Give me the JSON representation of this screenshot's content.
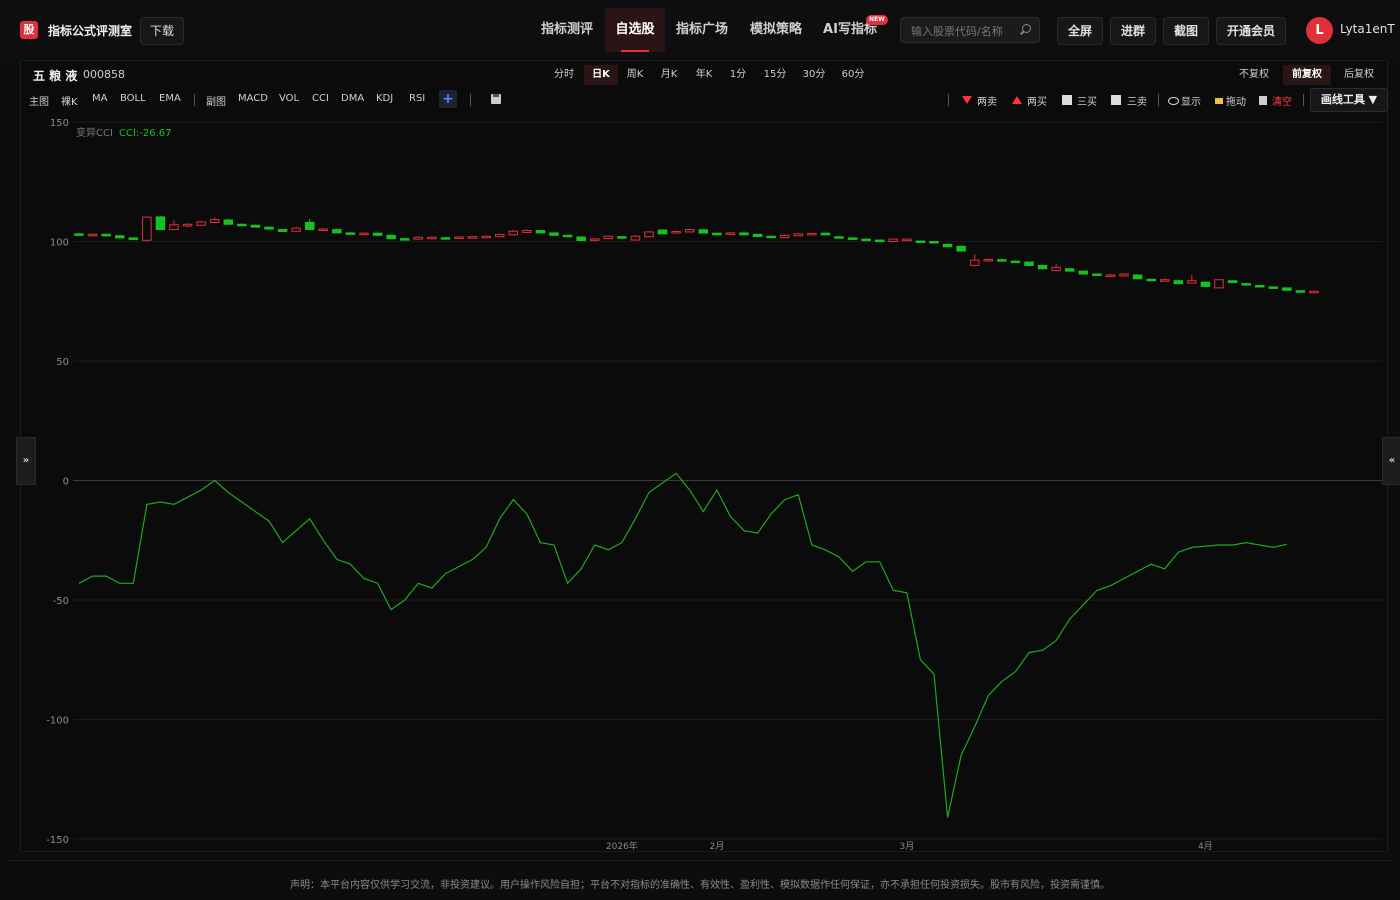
{
  "app": {
    "logo_char": "股",
    "title": "指标公式评测室",
    "download_label": "下载"
  },
  "nav": {
    "items": [
      {
        "label": "指标测评",
        "active": false
      },
      {
        "label": "自选股",
        "active": true
      },
      {
        "label": "指标广场",
        "active": false
      },
      {
        "label": "模拟策略",
        "active": false
      },
      {
        "label": "AI写指标",
        "active": false
      }
    ],
    "new_badge": "NEW"
  },
  "search": {
    "placeholder": "输入股票代码/名称"
  },
  "top_buttons": [
    "全屏",
    "进群",
    "截图",
    "开通会员"
  ],
  "user": {
    "avatar_letter": "L",
    "name": "Lyta1enT"
  },
  "stock": {
    "name": "五 粮 液",
    "code": "000858"
  },
  "periods": [
    {
      "label": "分时",
      "active": false
    },
    {
      "label": "日K",
      "active": true
    },
    {
      "label": "周K",
      "active": false
    },
    {
      "label": "月K",
      "active": false
    },
    {
      "label": "年K",
      "active": false
    },
    {
      "label": "1分",
      "active": false
    },
    {
      "label": "15分",
      "active": false
    },
    {
      "label": "30分",
      "active": false
    },
    {
      "label": "60分",
      "active": false
    }
  ],
  "adjust": [
    {
      "label": "不复权",
      "active": false
    },
    {
      "label": "前复权",
      "active": true
    },
    {
      "label": "后复权",
      "active": false
    }
  ],
  "indicators": [
    "主图",
    "裸K",
    "MA",
    "BOLL",
    "EMA",
    "副图",
    "MACD",
    "VOL",
    "CCI",
    "DMA",
    "KDJ",
    "RSI"
  ],
  "plus_label": "+",
  "tools": {
    "two_sell": "两卖",
    "two_buy": "两买",
    "three_buy": "三买",
    "three_sell": "三卖",
    "show": "显示",
    "drag": "拖动",
    "clear": "清空",
    "draw_tools": "画线工具 ▼"
  },
  "collapse_left": "»",
  "collapse_right": "«",
  "disclaimer": "声明：本平台内容仅供学习交流，非投资建议。用户操作风险自担；平台不对指标的准确性、有效性、盈利性、模拟数据作任何保证，亦不承担任何投资损失。股市有风险，投资需谨慎。",
  "colors": {
    "up": "#e0303a",
    "down": "#16c21e",
    "cci_line": "#1fa81f",
    "accent": "#e0303a"
  },
  "chart_data": {
    "type": "line",
    "legend": {
      "name": "变异CCI",
      "value_label": "CCI:-26.67"
    },
    "ylim": [
      -150,
      150
    ],
    "yticks": [
      150,
      100,
      50,
      0,
      -50,
      -100,
      -150
    ],
    "xtick_labels": [
      "2026年",
      "2月",
      "3月",
      "4月"
    ],
    "xtick_index": [
      40,
      47,
      61,
      83
    ],
    "candles": [
      {
        "o": 103.2,
        "c": 102.8,
        "h": 103.5,
        "l": 102.5
      },
      {
        "o": 102.8,
        "c": 103.0,
        "h": 103.3,
        "l": 102.6
      },
      {
        "o": 103.0,
        "c": 102.4,
        "h": 103.4,
        "l": 102.0
      },
      {
        "o": 102.4,
        "c": 101.5,
        "h": 102.6,
        "l": 101.3
      },
      {
        "o": 101.5,
        "c": 100.8,
        "h": 101.7,
        "l": 100.6
      },
      {
        "o": 100.5,
        "c": 110.2,
        "h": 110.5,
        "l": 100.2
      },
      {
        "o": 110.3,
        "c": 105.0,
        "h": 110.6,
        "l": 104.8
      },
      {
        "o": 105.0,
        "c": 107.0,
        "h": 108.8,
        "l": 104.9
      },
      {
        "o": 106.5,
        "c": 107.2,
        "h": 107.6,
        "l": 106.0
      },
      {
        "o": 106.8,
        "c": 108.2,
        "h": 108.6,
        "l": 106.6
      },
      {
        "o": 108.0,
        "c": 109.2,
        "h": 110.0,
        "l": 107.8
      },
      {
        "o": 109.0,
        "c": 107.2,
        "h": 109.6,
        "l": 107.0
      },
      {
        "o": 107.2,
        "c": 106.8,
        "h": 107.5,
        "l": 106.5
      },
      {
        "o": 106.8,
        "c": 106.0,
        "h": 107.0,
        "l": 105.8
      },
      {
        "o": 106.0,
        "c": 105.2,
        "h": 106.2,
        "l": 105.0
      },
      {
        "o": 105.0,
        "c": 104.2,
        "h": 105.2,
        "l": 104.0
      },
      {
        "o": 104.3,
        "c": 105.6,
        "h": 106.0,
        "l": 104.1
      },
      {
        "o": 108.0,
        "c": 105.0,
        "h": 109.5,
        "l": 104.8
      },
      {
        "o": 104.8,
        "c": 105.2,
        "h": 105.6,
        "l": 104.5
      },
      {
        "o": 105.0,
        "c": 103.6,
        "h": 105.2,
        "l": 103.4
      },
      {
        "o": 103.6,
        "c": 103.4,
        "h": 103.9,
        "l": 103.2
      },
      {
        "o": 103.0,
        "c": 103.5,
        "h": 103.8,
        "l": 102.6
      },
      {
        "o": 103.5,
        "c": 102.6,
        "h": 103.8,
        "l": 102.4
      },
      {
        "o": 102.6,
        "c": 101.2,
        "h": 102.8,
        "l": 101.0
      },
      {
        "o": 101.2,
        "c": 101.0,
        "h": 101.5,
        "l": 100.8
      },
      {
        "o": 101.0,
        "c": 101.8,
        "h": 102.2,
        "l": 100.8
      },
      {
        "o": 101.5,
        "c": 101.8,
        "h": 102.2,
        "l": 100.9
      },
      {
        "o": 101.6,
        "c": 101.2,
        "h": 101.9,
        "l": 101.0
      },
      {
        "o": 101.4,
        "c": 101.9,
        "h": 102.1,
        "l": 101.2
      },
      {
        "o": 101.7,
        "c": 102.0,
        "h": 102.3,
        "l": 101.5
      },
      {
        "o": 101.8,
        "c": 102.2,
        "h": 102.5,
        "l": 101.6
      },
      {
        "o": 102.0,
        "c": 102.9,
        "h": 103.3,
        "l": 101.8
      },
      {
        "o": 102.8,
        "c": 104.3,
        "h": 104.9,
        "l": 102.6
      },
      {
        "o": 103.8,
        "c": 104.6,
        "h": 105.0,
        "l": 103.5
      },
      {
        "o": 104.6,
        "c": 103.6,
        "h": 104.9,
        "l": 103.3
      },
      {
        "o": 103.6,
        "c": 102.6,
        "h": 103.8,
        "l": 102.4
      },
      {
        "o": 102.6,
        "c": 102.2,
        "h": 102.8,
        "l": 102.0
      },
      {
        "o": 101.9,
        "c": 100.4,
        "h": 102.0,
        "l": 100.2
      },
      {
        "o": 100.6,
        "c": 101.1,
        "h": 101.4,
        "l": 100.4
      },
      {
        "o": 101.2,
        "c": 102.2,
        "h": 102.4,
        "l": 101.0
      },
      {
        "o": 102.0,
        "c": 101.4,
        "h": 102.3,
        "l": 101.2
      },
      {
        "o": 100.6,
        "c": 102.2,
        "h": 102.6,
        "l": 100.4
      },
      {
        "o": 102.0,
        "c": 104.0,
        "h": 104.4,
        "l": 101.8
      },
      {
        "o": 104.8,
        "c": 103.2,
        "h": 105.0,
        "l": 103.0
      },
      {
        "o": 103.6,
        "c": 104.2,
        "h": 104.6,
        "l": 103.4
      },
      {
        "o": 104.0,
        "c": 105.0,
        "h": 105.3,
        "l": 103.8
      },
      {
        "o": 104.9,
        "c": 103.5,
        "h": 105.2,
        "l": 103.3
      },
      {
        "o": 103.5,
        "c": 102.8,
        "h": 103.7,
        "l": 102.6
      },
      {
        "o": 103.2,
        "c": 103.6,
        "h": 103.9,
        "l": 103.0
      },
      {
        "o": 103.6,
        "c": 102.8,
        "h": 103.8,
        "l": 102.6
      },
      {
        "o": 103.0,
        "c": 102.1,
        "h": 103.2,
        "l": 101.9
      },
      {
        "o": 102.2,
        "c": 101.6,
        "h": 102.4,
        "l": 101.4
      },
      {
        "o": 101.6,
        "c": 102.6,
        "h": 102.9,
        "l": 101.4
      },
      {
        "o": 102.4,
        "c": 103.2,
        "h": 103.5,
        "l": 102.2
      },
      {
        "o": 103.0,
        "c": 103.4,
        "h": 103.7,
        "l": 102.8
      },
      {
        "o": 103.5,
        "c": 102.8,
        "h": 103.7,
        "l": 102.6
      },
      {
        "o": 102.0,
        "c": 101.5,
        "h": 102.2,
        "l": 101.3
      },
      {
        "o": 101.5,
        "c": 101.0,
        "h": 101.7,
        "l": 100.8
      },
      {
        "o": 101.0,
        "c": 100.6,
        "h": 101.2,
        "l": 100.4
      },
      {
        "o": 100.6,
        "c": 100.2,
        "h": 100.8,
        "l": 100.0
      },
      {
        "o": 100.0,
        "c": 101.0,
        "h": 101.3,
        "l": 99.8
      },
      {
        "o": 100.4,
        "c": 101.0,
        "h": 101.2,
        "l": 100.2
      },
      {
        "o": 100.2,
        "c": 99.9,
        "h": 100.4,
        "l": 99.7
      },
      {
        "o": 100.0,
        "c": 99.8,
        "h": 100.2,
        "l": 99.6
      },
      {
        "o": 98.8,
        "c": 97.8,
        "h": 99.2,
        "l": 97.5
      },
      {
        "o": 98.0,
        "c": 96.0,
        "h": 98.2,
        "l": 95.8
      },
      {
        "o": 90.0,
        "c": 92.2,
        "h": 94.6,
        "l": 89.6
      },
      {
        "o": 92.0,
        "c": 92.5,
        "h": 93.0,
        "l": 91.6
      },
      {
        "o": 92.4,
        "c": 92.0,
        "h": 92.8,
        "l": 91.8
      },
      {
        "o": 91.8,
        "c": 91.2,
        "h": 92.0,
        "l": 91.0
      },
      {
        "o": 91.4,
        "c": 90.0,
        "h": 91.6,
        "l": 89.8
      },
      {
        "o": 90.0,
        "c": 88.6,
        "h": 90.2,
        "l": 88.4
      },
      {
        "o": 87.8,
        "c": 89.2,
        "h": 90.6,
        "l": 87.6
      },
      {
        "o": 88.6,
        "c": 87.6,
        "h": 88.8,
        "l": 87.4
      },
      {
        "o": 87.6,
        "c": 86.4,
        "h": 87.8,
        "l": 86.2
      },
      {
        "o": 86.4,
        "c": 85.8,
        "h": 86.6,
        "l": 85.6
      },
      {
        "o": 85.8,
        "c": 86.0,
        "h": 86.4,
        "l": 85.6
      },
      {
        "o": 85.6,
        "c": 86.4,
        "h": 86.8,
        "l": 85.4
      },
      {
        "o": 86.0,
        "c": 84.4,
        "h": 86.2,
        "l": 84.2
      },
      {
        "o": 84.2,
        "c": 83.6,
        "h": 84.4,
        "l": 83.4
      },
      {
        "o": 83.4,
        "c": 84.0,
        "h": 84.6,
        "l": 83.2
      },
      {
        "o": 83.6,
        "c": 82.4,
        "h": 84.0,
        "l": 82.2
      },
      {
        "o": 82.6,
        "c": 83.6,
        "h": 86.0,
        "l": 82.4
      },
      {
        "o": 83.0,
        "c": 81.2,
        "h": 83.2,
        "l": 81.0
      },
      {
        "o": 80.6,
        "c": 84.0,
        "h": 84.2,
        "l": 80.4
      },
      {
        "o": 83.6,
        "c": 82.8,
        "h": 83.8,
        "l": 82.6
      },
      {
        "o": 82.4,
        "c": 81.8,
        "h": 82.6,
        "l": 81.6
      },
      {
        "o": 81.6,
        "c": 81.0,
        "h": 81.8,
        "l": 80.8
      },
      {
        "o": 81.0,
        "c": 80.4,
        "h": 81.2,
        "l": 80.2
      },
      {
        "o": 80.6,
        "c": 79.6,
        "h": 80.8,
        "l": 79.4
      },
      {
        "o": 79.4,
        "c": 79.0,
        "h": 79.6,
        "l": 78.8
      },
      {
        "o": 78.8,
        "c": 79.2,
        "h": 79.4,
        "l": 78.6
      }
    ],
    "cci": [
      -43,
      -40,
      -40,
      -43,
      -43,
      -10,
      -9,
      -10,
      -7,
      -4,
      0,
      -5,
      -9,
      -13,
      -17,
      -26,
      -21,
      -16,
      -25,
      -33,
      -35,
      -41,
      -43,
      -54,
      -50,
      -43,
      -45,
      -39,
      -36,
      -33,
      -28,
      -16,
      -8,
      -14,
      -26,
      -27,
      -43,
      -37,
      -27,
      -29,
      -26,
      -16,
      -5,
      -1,
      3,
      -4,
      -13,
      -4,
      -15,
      -21,
      -22,
      -14,
      -8,
      -6,
      -27,
      -29,
      -32,
      -38,
      -34,
      -34,
      -46,
      -47,
      -75,
      -81,
      -141,
      -115,
      -103,
      -90,
      -84,
      -80,
      -72,
      -71,
      -67,
      -58,
      -52,
      -46,
      -44,
      -41,
      -38,
      -35,
      -37,
      -30,
      -28,
      -27.5,
      -27,
      -27,
      -26,
      -27,
      -28,
      -26.67
    ]
  }
}
